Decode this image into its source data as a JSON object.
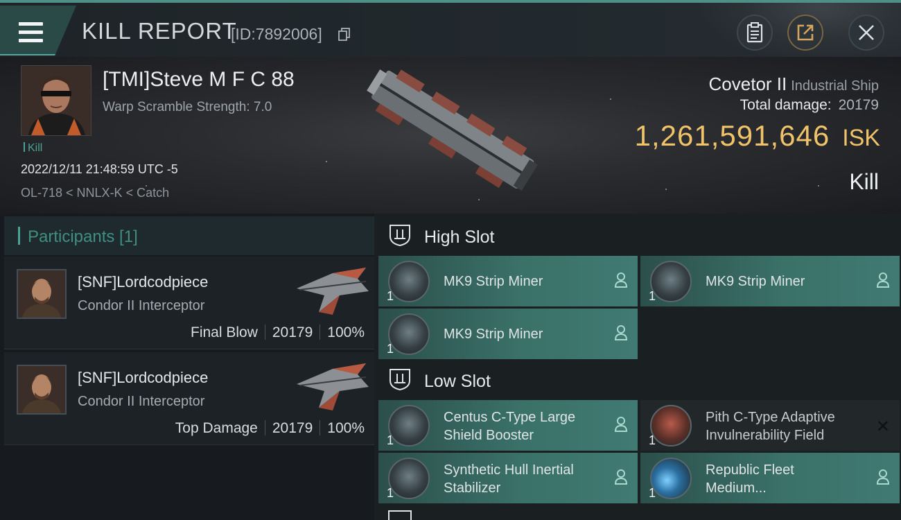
{
  "header": {
    "title": "KILL REPORT",
    "id_text": "[ID:7892006]",
    "buttons": [
      "clipboard-icon",
      "share-icon",
      "close-icon"
    ]
  },
  "victim": {
    "pilot": "[TMI]Steve M F C 88",
    "warp_scramble": "Warp Scramble Strength: 7.0",
    "tag": "Kill",
    "datetime": "2022/12/11 21:48:59 UTC -5",
    "location": "OL-718 < NNLX-K < Catch",
    "ship_name": "Covetor II",
    "ship_class": "Industrial Ship",
    "total_damage_label": "Total damage:",
    "total_damage": "20179",
    "isk_value": "1,261,591,646",
    "isk_unit": "ISK",
    "result": "Kill"
  },
  "participants": {
    "header": "Participants [1]",
    "rows": [
      {
        "name": "[SNF]Lordcodpiece",
        "ship": "Condor II Interceptor",
        "role": "Final Blow",
        "damage": "20179",
        "percent": "100%"
      },
      {
        "name": "[SNF]Lordcodpiece",
        "ship": "Condor II Interceptor",
        "role": "Top Damage",
        "damage": "20179",
        "percent": "100%"
      }
    ]
  },
  "fitting": {
    "high_slot": {
      "title": "High Slot",
      "modules": [
        {
          "name": "MK9 Strip Miner",
          "qty": "1"
        },
        {
          "name": "MK9 Strip Miner",
          "qty": "1"
        },
        {
          "name": "MK9 Strip Miner",
          "qty": "1"
        }
      ]
    },
    "low_slot": {
      "title": "Low Slot",
      "modules": [
        {
          "name_l1": "Centus C-Type Large",
          "name_l2": "Shield Booster",
          "qty": "1",
          "state": "dropped"
        },
        {
          "name_l1": "Pith C-Type Adaptive",
          "name_l2": "Invulnerability Field",
          "qty": "1",
          "state": "destroyed"
        },
        {
          "name_l1": "Synthetic Hull Inertial",
          "name_l2": "Stabilizer",
          "qty": "1",
          "state": "dropped"
        },
        {
          "name_l1": "Republic Fleet",
          "name_l2": "Medium...",
          "qty": "1",
          "state": "dropped"
        }
      ]
    },
    "colors": {
      "dropped": "#3a7169",
      "destroyed": "#222729",
      "accent": "#4aa394",
      "isk": "#f0c36a"
    }
  }
}
